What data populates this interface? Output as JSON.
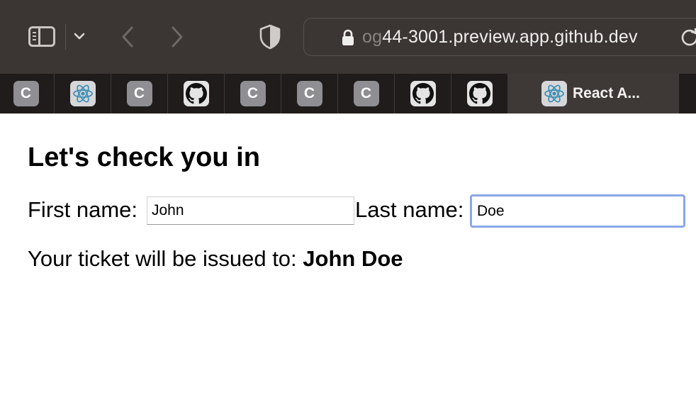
{
  "browser": {
    "url_faded": "og",
    "url_main": "44-3001.preview.app.github.dev",
    "tabs": [
      {
        "icon": "c-letter-icon",
        "letter": "C"
      },
      {
        "icon": "react-icon"
      },
      {
        "icon": "c-letter-icon",
        "letter": "C"
      },
      {
        "icon": "github-icon"
      },
      {
        "icon": "c-letter-icon",
        "letter": "C"
      },
      {
        "icon": "c-letter-icon",
        "letter": "C"
      },
      {
        "icon": "c-letter-icon",
        "letter": "C"
      },
      {
        "icon": "github-icon"
      },
      {
        "icon": "github-icon"
      }
    ],
    "active_tab": {
      "icon": "react-icon",
      "title": "React A..."
    }
  },
  "page": {
    "heading": "Let's check you in",
    "first_name_label": "First name:",
    "first_name_value": "John",
    "last_name_label": "Last name:",
    "last_name_value": "Doe",
    "ticket_prefix": "Your ticket will be issued to:",
    "ticket_name": "John Doe"
  },
  "colors": {
    "toolbar_bg": "#3b3634",
    "tabstrip_bg": "#1f1c1b",
    "active_tab_bg": "#3e3937",
    "focus_ring": "#8aa7e8"
  }
}
